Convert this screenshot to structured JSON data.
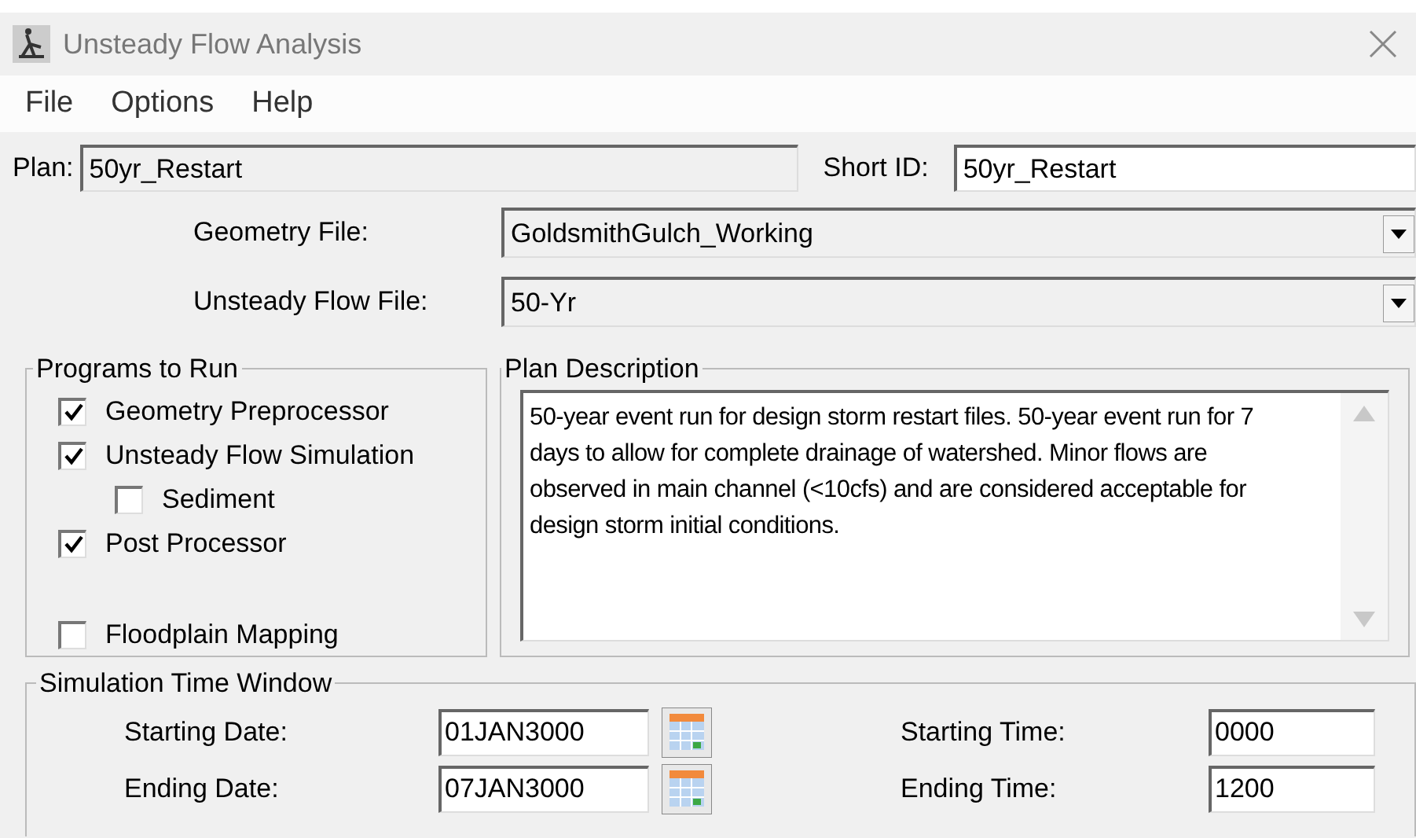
{
  "window": {
    "title": "Unsteady Flow Analysis"
  },
  "menu": [
    "File",
    "Options",
    "Help"
  ],
  "plan": {
    "label": "Plan:",
    "value": "50yr_Restart"
  },
  "short_id": {
    "label": "Short ID:",
    "value": "50yr_Restart"
  },
  "files": [
    {
      "label": "Geometry File:",
      "value": "GoldsmithGulch_Working"
    },
    {
      "label": "Unsteady Flow File:",
      "value": "50-Yr"
    }
  ],
  "programs": {
    "title": "Programs to Run",
    "items": [
      {
        "label": "Geometry Preprocessor",
        "checked": true
      },
      {
        "label": "Unsteady Flow Simulation",
        "checked": true,
        "children": [
          {
            "label": "Sediment",
            "checked": false
          }
        ]
      },
      {
        "label": "Post Processor",
        "checked": true
      },
      {
        "label": "Floodplain Mapping",
        "checked": false
      }
    ]
  },
  "description": {
    "title": "Plan Description",
    "text": "50-year event run for design storm restart files. 50-year event run for 7 days to allow for complete drainage of watershed. Minor flows are observed in main channel (<10cfs) and are considered acceptable for design storm initial conditions."
  },
  "time_window": {
    "title": "Simulation Time Window",
    "dates": [
      {
        "label": "Starting Date:",
        "value": "01JAN3000"
      },
      {
        "label": "Ending Date:",
        "value": "07JAN3000"
      }
    ],
    "times": [
      {
        "label": "Starting Time:",
        "value": "0000"
      },
      {
        "label": "Ending Time:",
        "value": "1200"
      }
    ]
  }
}
